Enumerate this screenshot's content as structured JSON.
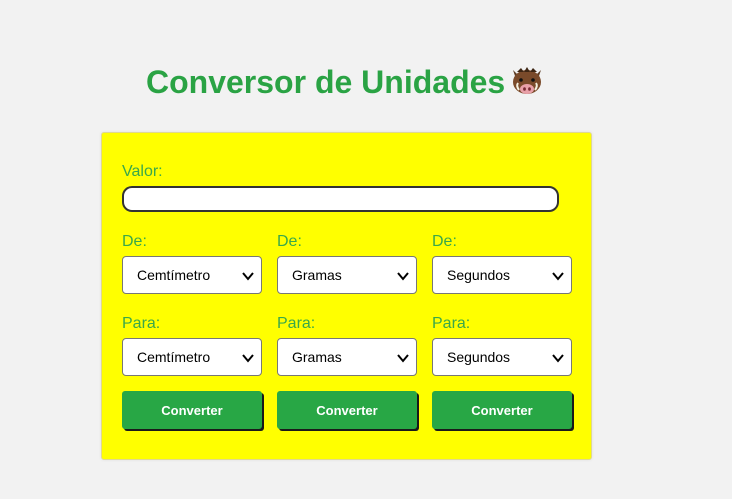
{
  "header": {
    "title": "Conversor de Unidades",
    "icon": "boar-icon"
  },
  "form": {
    "value_label": "Valor:",
    "value_input": "",
    "columns": [
      {
        "from_label": "De:",
        "from_selected": "Cemtímetro",
        "to_label": "Para:",
        "to_selected": "Cemtímetro",
        "button_label": "Converter"
      },
      {
        "from_label": "De:",
        "from_selected": "Gramas",
        "to_label": "Para:",
        "to_selected": "Gramas",
        "button_label": "Converter"
      },
      {
        "from_label": "De:",
        "from_selected": "Segundos",
        "to_label": "Para:",
        "to_selected": "Segundos",
        "button_label": "Converter"
      }
    ]
  },
  "colors": {
    "background": "#f2f2f2",
    "card": "#ffff00",
    "accent_green": "#28a745",
    "title_green": "#2aa344"
  }
}
